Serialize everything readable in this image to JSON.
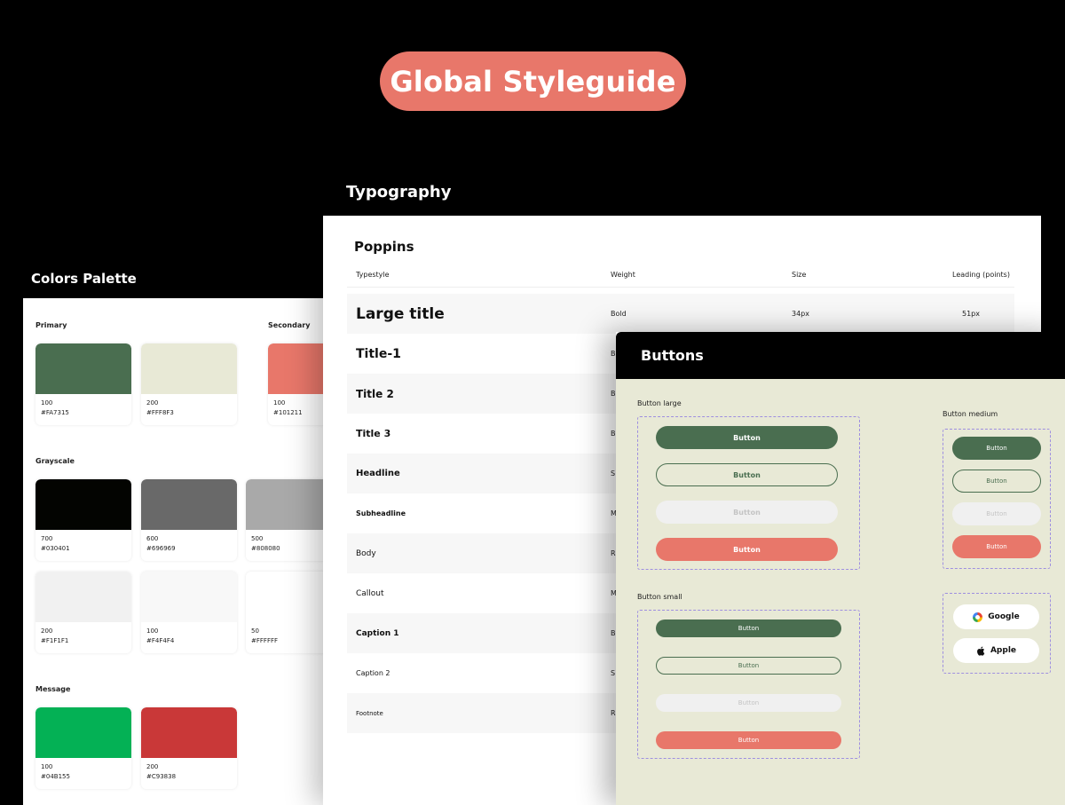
{
  "hero": {
    "title": "Global Styleguide"
  },
  "colors": {
    "title": "Colors Palette",
    "primary_label": "Primary",
    "secondary_label": "Secondary",
    "grayscale_label": "Grayscale",
    "message_label": "Message",
    "primary": [
      {
        "num": "100",
        "hex": "#FA7315",
        "color": "#4A6E50"
      },
      {
        "num": "200",
        "hex": "#FFF8F3",
        "color": "#E8E9D6"
      }
    ],
    "secondary": [
      {
        "num": "100",
        "hex": "#101211",
        "color": "#E8776A"
      }
    ],
    "grayscale": [
      {
        "num": "700",
        "hex": "#030401",
        "color": "#030401"
      },
      {
        "num": "600",
        "hex": "#696969",
        "color": "#696969"
      },
      {
        "num": "500",
        "hex": "#808080",
        "color": "#A9A9A9"
      },
      {
        "num": "200",
        "hex": "#F1F1F1",
        "color": "#F1F1F1"
      },
      {
        "num": "100",
        "hex": "#F4F4F4",
        "color": "#F8F8F8"
      },
      {
        "num": "50",
        "hex": "#FFFFFF",
        "color": "#FFFFFF"
      }
    ],
    "message": [
      {
        "num": "100",
        "hex": "#04B155",
        "color": "#04B155"
      },
      {
        "num": "200",
        "hex": "#C93838",
        "color": "#C93838"
      }
    ]
  },
  "typography": {
    "title": "Typography",
    "font_name": "Poppins",
    "columns": {
      "typestyle": "Typestyle",
      "weight": "Weight",
      "size": "Size",
      "leading": "Leading (points)"
    },
    "rows": [
      {
        "name": "Large title",
        "weight": "Bold",
        "size": "34px",
        "leading": "51px"
      },
      {
        "name": "Title-1",
        "weight": "B",
        "size": "",
        "leading": ""
      },
      {
        "name": "Title 2",
        "weight": "B",
        "size": "",
        "leading": ""
      },
      {
        "name": "Title 3",
        "weight": "B",
        "size": "",
        "leading": ""
      },
      {
        "name": "Headline",
        "weight": "S",
        "size": "",
        "leading": ""
      },
      {
        "name": "Subheadline",
        "weight": "M",
        "size": "",
        "leading": ""
      },
      {
        "name": "Body",
        "weight": "R",
        "size": "",
        "leading": ""
      },
      {
        "name": "Callout",
        "weight": "M",
        "size": "",
        "leading": ""
      },
      {
        "name": "Caption 1",
        "weight": "B",
        "size": "",
        "leading": ""
      },
      {
        "name": "Caption 2",
        "weight": "S",
        "size": "",
        "leading": ""
      },
      {
        "name": "Footnote",
        "weight": "R",
        "size": "",
        "leading": ""
      }
    ]
  },
  "buttons": {
    "title": "Buttons",
    "large_label": "Button large",
    "medium_label": "Button medium",
    "small_label": "Button small",
    "button_text": "Button",
    "google": "Google",
    "apple": "Apple",
    "colors": {
      "primary": "#4A6E50",
      "coral": "#E8776A",
      "disabled": "#F0F0F0",
      "background": "#E8E9D6"
    }
  }
}
